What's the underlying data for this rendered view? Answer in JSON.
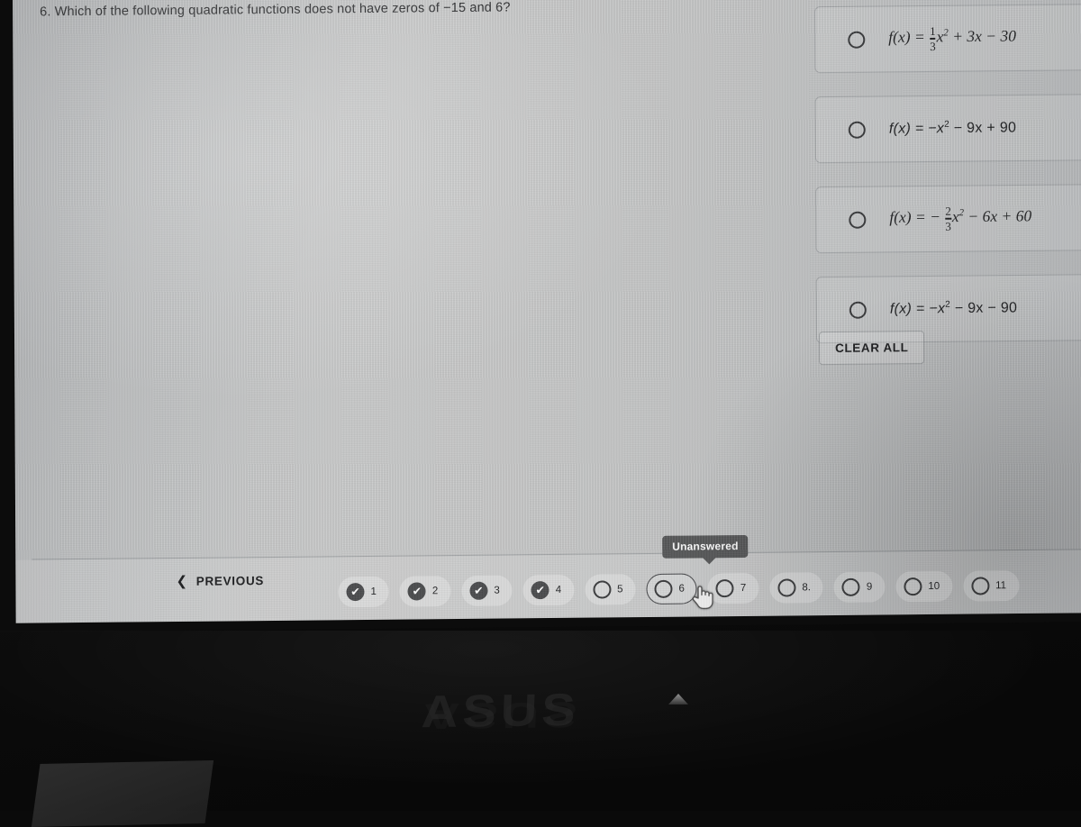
{
  "question": {
    "number": "6.",
    "text": "6. Which of the following quadratic functions does not have zeros of −15 and 6?"
  },
  "options": [
    {
      "id": "option-a",
      "style": "math",
      "selected": false,
      "text": "f(x) = 1/3 x² + 3x − 30",
      "parts": {
        "lhs": "f(x) =",
        "frac_num": "1",
        "frac_den": "3",
        "var": "x",
        "exp": "2",
        "rest": "+ 3x − 30"
      }
    },
    {
      "id": "option-b",
      "style": "sans",
      "selected": false,
      "text": "f(x) = −x² − 9x + 90",
      "parts": {
        "lhs": "f(x) =",
        "frac_num": "",
        "frac_den": "",
        "var": "−x",
        "exp": "2",
        "rest": "− 9x + 90"
      }
    },
    {
      "id": "option-c",
      "style": "math",
      "selected": false,
      "text": "f(x) = − 2/3 x² − 6x + 60",
      "parts": {
        "lhs": "f(x) = −",
        "frac_num": "2",
        "frac_den": "3",
        "var": "x",
        "exp": "2",
        "rest": "− 6x + 60"
      }
    },
    {
      "id": "option-d",
      "style": "sans",
      "selected": false,
      "text": "f(x) = −x² − 9x − 90",
      "parts": {
        "lhs": "f(x) =",
        "frac_num": "",
        "frac_den": "",
        "var": "−x",
        "exp": "2",
        "rest": "− 9x − 90"
      }
    }
  ],
  "clear_all_label": "CLEAR ALL",
  "nav": {
    "previous_label": "PREVIOUS",
    "previous_chevron": "❮",
    "tooltip": "Unanswered",
    "check_glyph": "✔",
    "pages": [
      {
        "label": "1",
        "state": "answered"
      },
      {
        "label": "2",
        "state": "answered"
      },
      {
        "label": "3",
        "state": "answered"
      },
      {
        "label": "4",
        "state": "answered"
      },
      {
        "label": "5",
        "state": "unanswered"
      },
      {
        "label": "6",
        "state": "unanswered",
        "current": true
      },
      {
        "label": "7",
        "state": "unanswered"
      },
      {
        "label": "8.",
        "state": "unanswered"
      },
      {
        "label": "9",
        "state": "unanswered"
      },
      {
        "label": "10",
        "state": "unanswered"
      },
      {
        "label": "11",
        "state": "unanswered"
      }
    ]
  },
  "hardware": {
    "brand": "ASUS"
  },
  "colors": {
    "screen_light": "#c6c7c7",
    "text_dark": "#1f2022",
    "tooltip_bg": "#575859",
    "answered_circle": "#4b4c4e",
    "bezel": "#0c0c0c"
  }
}
